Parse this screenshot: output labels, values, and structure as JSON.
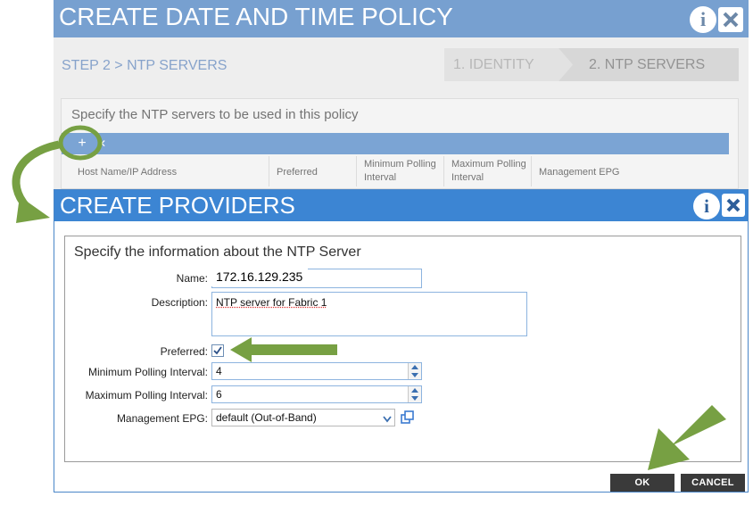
{
  "background_dialog": {
    "title": "CREATE DATE AND TIME POLICY",
    "info_icon": "info-icon",
    "close_icon": "close-icon",
    "step_label": "STEP 2 > NTP SERVERS",
    "wizard_steps": [
      "1. IDENTITY",
      "2. NTP SERVERS"
    ],
    "panel_description": "Specify the NTP servers to be used in this policy",
    "columns": [
      "Host Name/IP Address",
      "Preferred",
      "Minimum Polling Interval",
      "Maximum Polling Interval",
      "Management EPG"
    ]
  },
  "dialog": {
    "title": "CREATE PROVIDERS",
    "description": "Specify the information about the NTP Server",
    "fields": {
      "name": {
        "label": "Name:",
        "value": "172.16.129.235"
      },
      "description": {
        "label": "Description:",
        "value": "NTP server for Fabric 1"
      },
      "preferred": {
        "label": "Preferred:",
        "checked": true
      },
      "min_polling": {
        "label": "Minimum Polling Interval:",
        "value": "4"
      },
      "max_polling": {
        "label": "Maximum Polling Interval:",
        "value": "6"
      },
      "management_epg": {
        "label": "Management EPG:",
        "value": "default (Out-of-Band)"
      }
    },
    "buttons": {
      "ok": "OK",
      "cancel": "CANCEL"
    }
  },
  "colors": {
    "header_blue": "#3c85d3",
    "faded_header_blue": "#5a8cc6",
    "annotation_green": "#77a043",
    "button_dark": "#3a3a3a"
  }
}
